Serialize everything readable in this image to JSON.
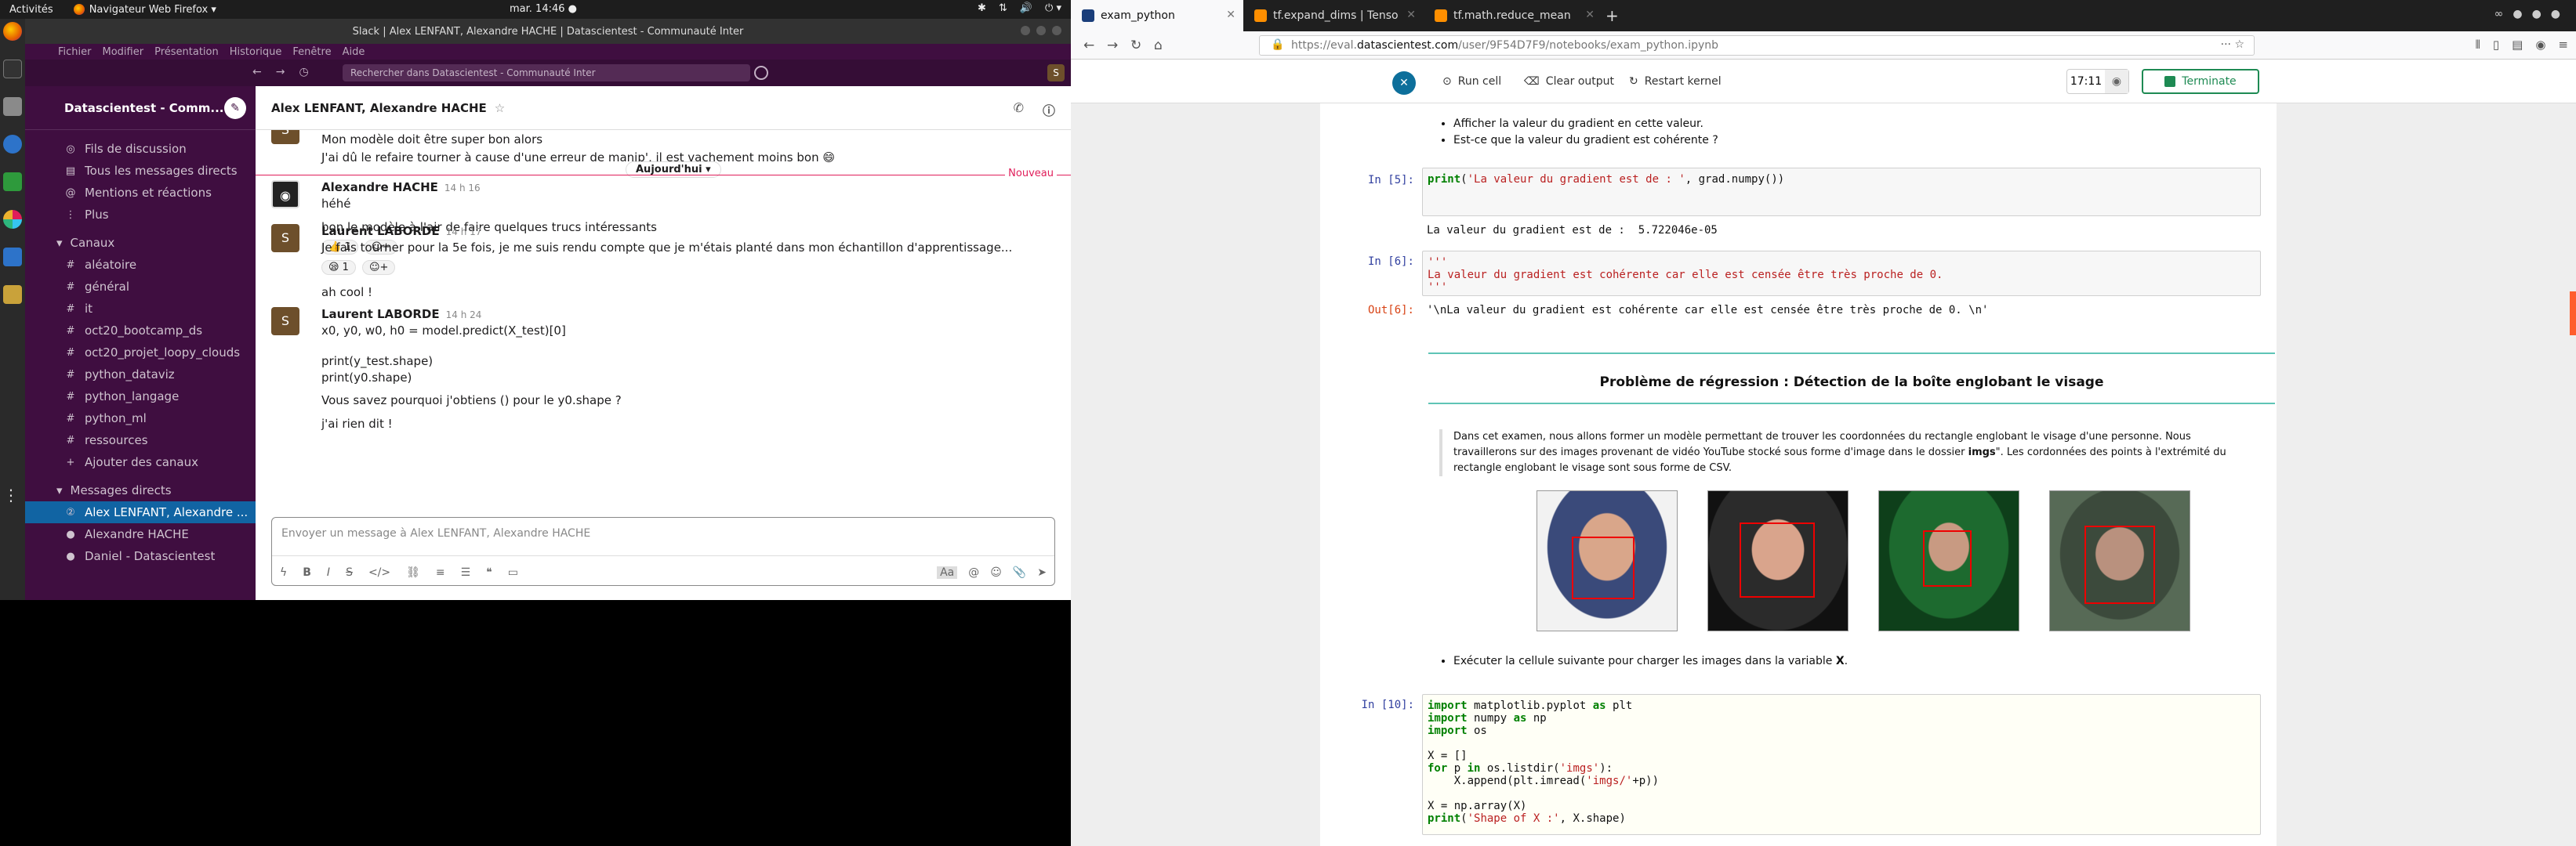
{
  "topbar": {
    "activities": "Activités",
    "app": "Navigateur Web Firefox ▾",
    "clock": "mar. 14:46 ●",
    "tray": [
      "✱",
      "⇅",
      "🔊",
      "⏻ ▾"
    ]
  },
  "slack": {
    "title": "Slack | Alex LENFANT, Alexandre HACHE | Datascientest - Communauté Inter",
    "menu": [
      "Fichier",
      "Modifier",
      "Présentation",
      "Historique",
      "Fenêtre",
      "Aide"
    ],
    "search_placeholder": "Rechercher dans Datascientest - Communauté Inter",
    "avatar_letter": "S",
    "workspace": "Datascientest - Comm...",
    "nav": [
      {
        "icon": "◎",
        "label": "Fils de discussion"
      },
      {
        "icon": "▤",
        "label": "Tous les messages directs"
      },
      {
        "icon": "@",
        "label": "Mentions et réactions"
      },
      {
        "icon": "⋮",
        "label": "Plus"
      }
    ],
    "channels_header": "Canaux",
    "channels": [
      "aléatoire",
      "général",
      "it",
      "oct20_bootcamp_ds",
      "oct20_projet_loopy_clouds",
      "python_dataviz",
      "python_langage",
      "python_ml",
      "ressources"
    ],
    "add_channels": "Ajouter des canaux",
    "dm_header": "Messages directs",
    "dms": [
      "Alex LENFANT, Alexandre ...",
      "Alexandre HACHE",
      "Daniel - Datascientest"
    ],
    "channel_title": "Alex LENFANT, Alexandre HACHE",
    "day_pill": "Aujourd'hui ▾",
    "divider_label": "Nouveau",
    "messages": {
      "m0_line1": "Mon modèle doit être super bon alors",
      "m0_line2": "J'ai dû le refaire tourner à cause d'une erreur de manip', il est vachement moins bon 😄",
      "m1_name": "Alexandre HACHE",
      "m1_time": "14 h 16",
      "m1_line1": "héhé",
      "m1_line2": "bon le modèle à l'air de faire quelques trucs intéressants",
      "m1_react": "👍 1",
      "m2_name": "Laurent LABORDE",
      "m2_time": "14 h 17",
      "m2_line1": "Je fais tourner pour la 5e fois, je me suis rendu compte que je m'étais planté dans mon échantillon d'apprentissage...",
      "m2_react": "😪 1",
      "m2_line2": "ah cool !",
      "m3_name": "Laurent LABORDE",
      "m3_time": "14 h 24",
      "m3_line1": "x0, y0, w0, h0 = model.predict(X_test)[0]",
      "m3_line2": "print(y_test.shape)",
      "m3_line3": "print(y0.shape)",
      "m3_line4": "Vous savez pourquoi j'obtiens () pour le y0.shape ?",
      "m3_line5": "j'ai rien dit !"
    },
    "composer_placeholder": "Envoyer un message à Alex LENFANT, Alexandre HACHE"
  },
  "firefox": {
    "tabs": [
      "exam_python",
      "tf.expand_dims | Tenso",
      "tf.math.reduce_mean"
    ],
    "url_prefix": "https://eval.",
    "url_domain": "datascientest.com",
    "url_rest": "/user/9F54D7F9/notebooks/exam_python.ipynb"
  },
  "jupyter": {
    "run_cell": "Run cell",
    "clear_output": "Clear output",
    "restart_kernel": "Restart kernel",
    "timer": "17:11",
    "terminate": "Terminate",
    "bullets_top": [
      "Afficher la valeur du gradient en cette valeur.",
      "Est-ce que la valeur du gradient est cohérente ?"
    ],
    "p5": "In [5]:",
    "out5": "La valeur du gradient est de :  5.722046e-05",
    "p6": "In [6]:",
    "c6_l1": "'''",
    "c6_l2": "La valeur du gradient est cohérente car elle est censée être très proche de 0.",
    "c6_l3": "'''",
    "o6": "Out[6]:",
    "out6": "'\\nLa valeur du gradient est cohérente car elle est censée être très proche de 0. \\n'",
    "section_title": "Problème de régression : Détection de la boîte englobant le visage",
    "quote_a": "Dans cet examen, nous allons former un modèle permettant de trouver les coordonnées du rectangle englobant le visage d'une personne. Nous travaillerons sur des images provenant de vidéo YouTube stocké sous forme d'image dans le dossier ",
    "quote_bold": "imgs",
    "quote_b": "\". Les cordonnées des points à l'extrémité du rectangle englobant le visage sont sous forme de CSV.",
    "bullet_exec_a": "Exécuter la cellule suivante pour charger les images dans la variable ",
    "bullet_exec_b": "X",
    "p10": "In [10]:"
  }
}
